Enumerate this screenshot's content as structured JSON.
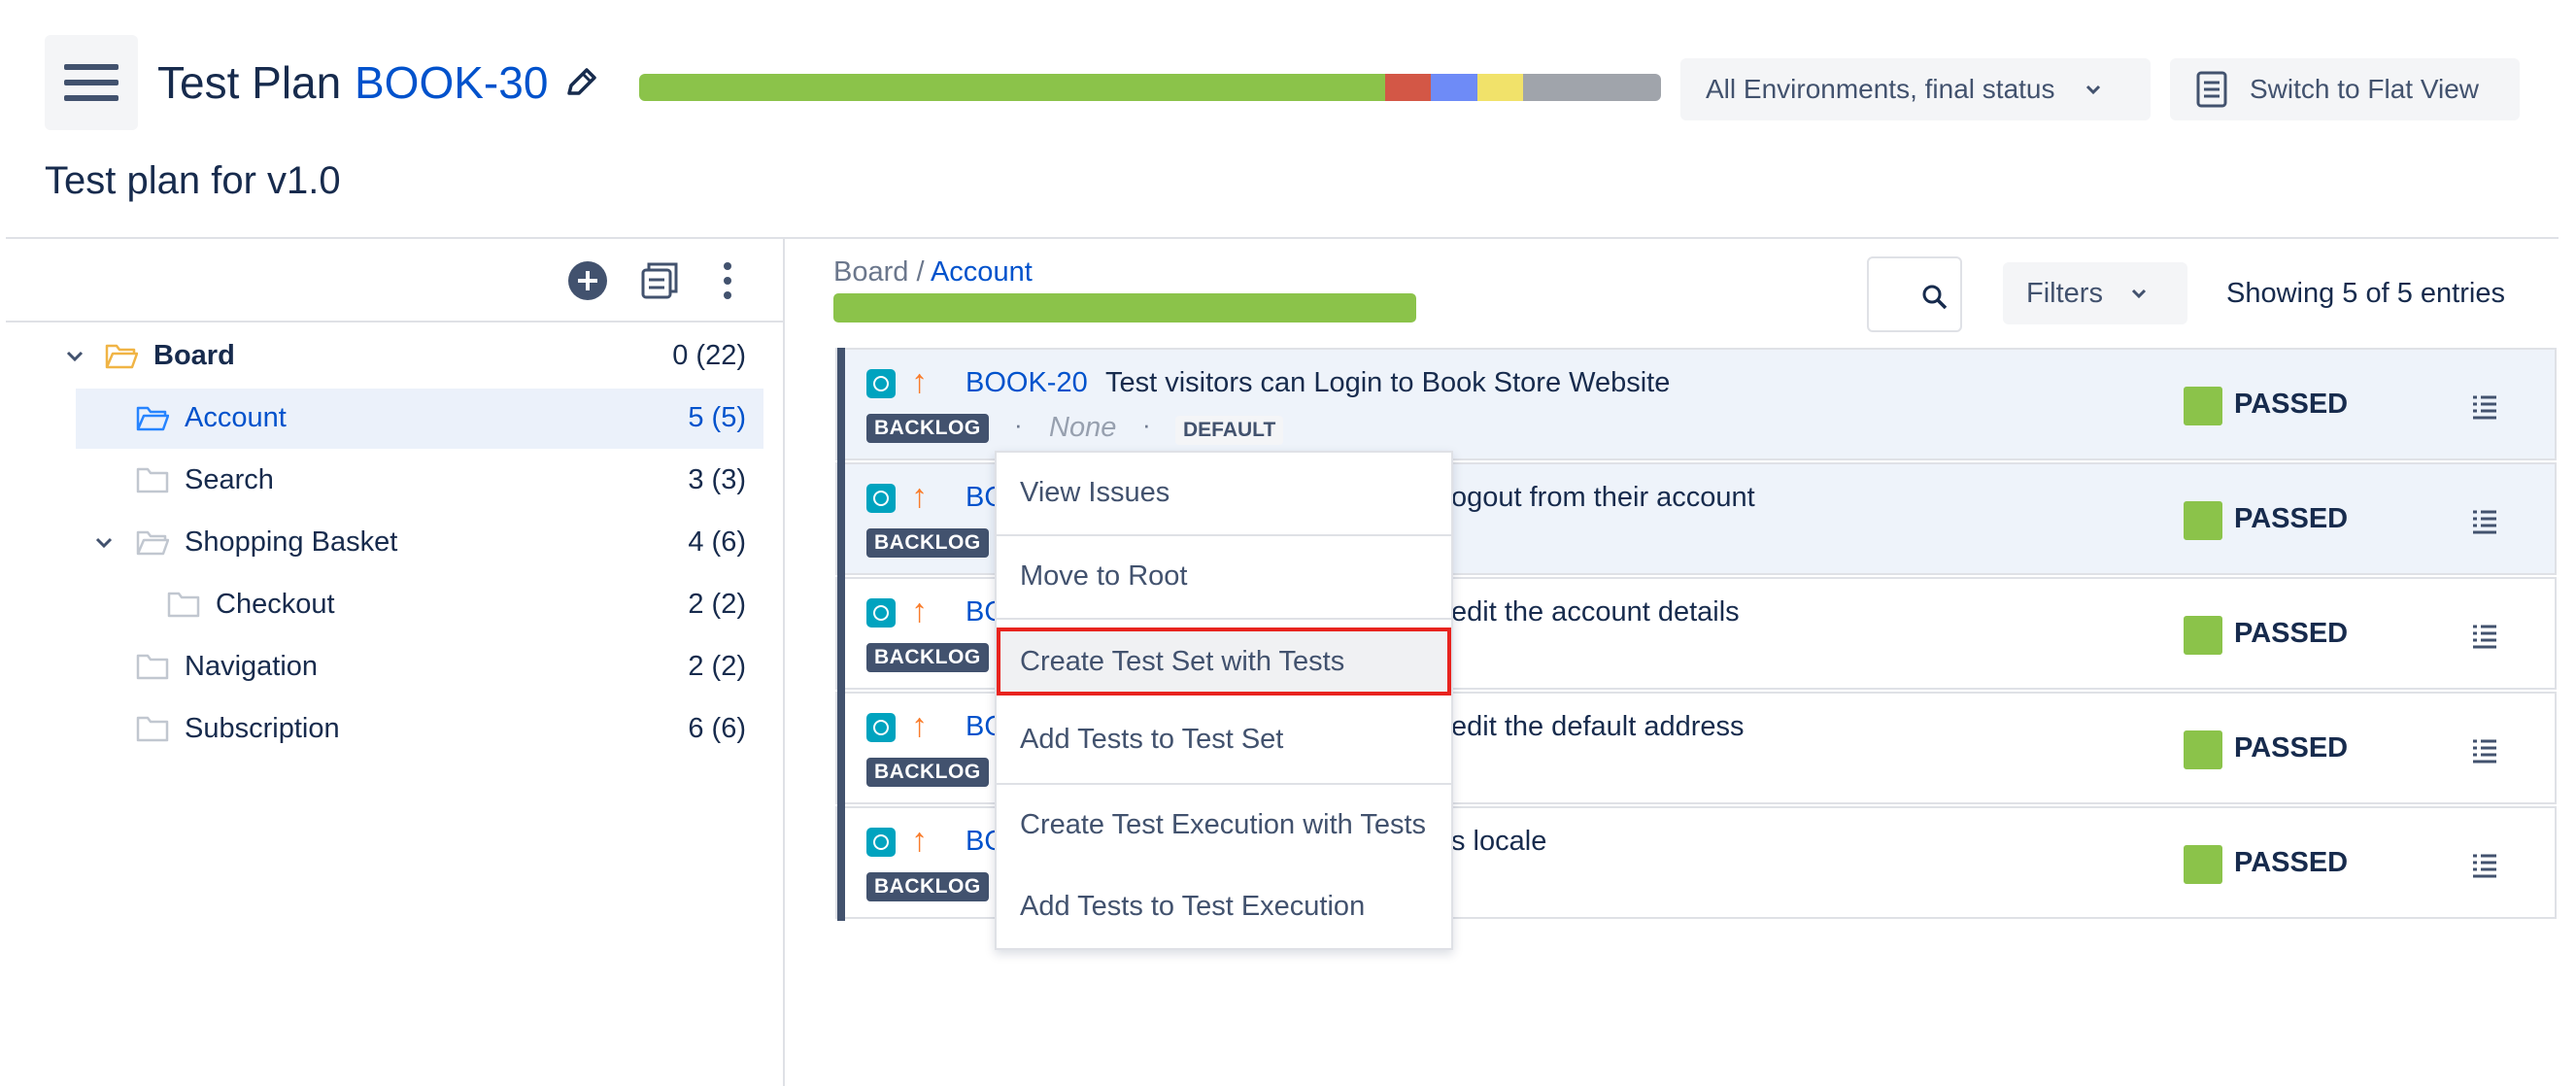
{
  "header": {
    "title_word": "Test Plan",
    "issue_key": "BOOK-30",
    "subtitle": "Test plan for v1.0",
    "progress": [
      {
        "status": "passed",
        "fraction": 0.73,
        "color": "#8BC34A"
      },
      {
        "status": "failed",
        "fraction": 0.045,
        "color": "#D35746"
      },
      {
        "status": "executing",
        "fraction": 0.045,
        "color": "#6E8BF7"
      },
      {
        "status": "todo",
        "fraction": 0.045,
        "color": "#F1E26A"
      },
      {
        "status": "other",
        "fraction": 0.135,
        "color": "#A0A4AB"
      }
    ],
    "environment_select": "All Environments, final status",
    "flat_view_button": "Switch to Flat View"
  },
  "tree": {
    "items": [
      {
        "label": "Board",
        "count": "0 (22)"
      },
      {
        "label": "Account",
        "count": "5 (5)"
      },
      {
        "label": "Search",
        "count": "3 (3)"
      },
      {
        "label": "Shopping Basket",
        "count": "4 (6)"
      },
      {
        "label": "Checkout",
        "count": "2 (2)"
      },
      {
        "label": "Navigation",
        "count": "2 (2)"
      },
      {
        "label": "Subscription",
        "count": "6 (6)"
      }
    ]
  },
  "panel": {
    "breadcrumb_root": "Board",
    "breadcrumb_sep": " / ",
    "breadcrumb_current": "Account",
    "filters_label": "Filters",
    "showing": "Showing 5 of 5 entries"
  },
  "rows": [
    {
      "key": "BOOK-20",
      "summary": "Test visitors can Login to Book Store Website",
      "status_lozenge": "BACKLOG",
      "none": "None",
      "tag": "DEFAULT",
      "result": "PASSED",
      "bullet": "·"
    },
    {
      "key_visible": "BO",
      "summary_tail": "ogout from their account",
      "status_lozenge": "BACKLOG",
      "result": "PASSED"
    },
    {
      "key_visible": "BO",
      "summary_tail": "edit the account details",
      "status_lozenge": "BACKLOG",
      "result": "PASSED"
    },
    {
      "key_visible": "BO",
      "summary_tail": "edit the default address",
      "status_lozenge": "BACKLOG",
      "result": "PASSED"
    },
    {
      "key_visible": "BO",
      "summary_tail": "s locale",
      "status_lozenge": "BACKLOG",
      "result": "PASSED"
    }
  ],
  "context_menu": {
    "items": [
      "View Issues",
      "Move to Root",
      "Create Test Set with Tests",
      "Add Tests to Test Set",
      "Create Test Execution with Tests",
      "Add Tests to Test Execution"
    ],
    "highlighted": "Create Test Set with Tests"
  }
}
